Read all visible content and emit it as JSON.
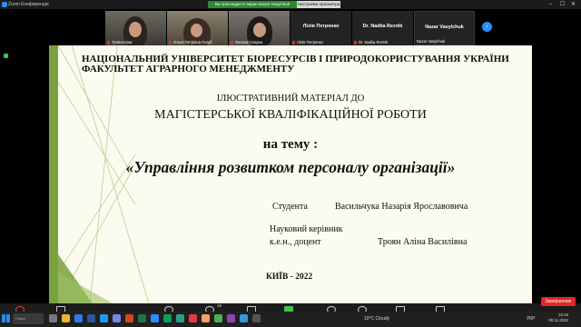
{
  "window": {
    "title": "Zoom Конференція",
    "share_banner": "Ви проглядаєте екран Nazar Vasylchuk",
    "view_options": "Настройки просмотра ▾"
  },
  "participants": [
    {
      "name": "ТроянАліна",
      "kind": "video"
    },
    {
      "name": "Ольга Петрівна Голуб",
      "kind": "video"
    },
    {
      "name": "Оксана Гагарка",
      "kind": "video"
    },
    {
      "name": "Лілія Петренко",
      "label": "Лілія Петренко",
      "kind": "name"
    },
    {
      "name": "Dr. Nadiia Reznik",
      "label": "Dr. Nadiia Reznik",
      "kind": "name"
    },
    {
      "name": "Nazar Vasylchuk",
      "label": "Nazar Vasylchuk",
      "kind": "name"
    }
  ],
  "slide": {
    "university_line1": "НАЦІОНАЛЬНИЙ УНІВЕРСИТЕТ БІОРЕСУРСІВ І ПРИРОДОКОРИСТУВАННЯ УКРАЇНИ",
    "university_line2": "ФАКУЛЬТЕТ АГРАРНОГО МЕНЕДЖМЕНТУ",
    "subtitle": "ІЛЮСТРАТИВНИЙ МАТЕРІАЛ ДО",
    "work_type": "МАГІСТЕРСЬКОЇ  КВАЛІФІКАЦІЙНОЇ РОБОТИ",
    "topic_intro": "на тему :",
    "topic": "«Управління розвитком персоналу організації»",
    "student_label": "Студента",
    "student_name": "Васильчука Назарія Ярославовича",
    "supervisor_label": "Науковий керівник",
    "supervisor_degree": "к.е.н., доцент",
    "supervisor_name": "Троян Аліна Василівна",
    "city_year": "КИЇВ - 2022"
  },
  "controls": {
    "unmute": "Включить звук",
    "stop_video": "Остановить видео",
    "security": "Безопасность",
    "participants": "Участники",
    "participants_count": "16",
    "chat": "Чат",
    "share_screen": "Демонстрация экрана",
    "record": "Запись",
    "reactions": "Реакции",
    "apps": "Приложения",
    "whiteboard": "Доска сообщений",
    "end": "Завершение"
  },
  "taskbar": {
    "search_placeholder": "Поиск",
    "weather": "10°C Cloudy",
    "language": "УКР",
    "time": "16:19",
    "date": "09.11.2022"
  },
  "colors": {
    "slide_background": "#fbfbef",
    "slide_accent": "#7aa13f",
    "zoom_blue": "#2d8cff",
    "end_red": "#e02828",
    "share_green": "#2a8a30"
  }
}
